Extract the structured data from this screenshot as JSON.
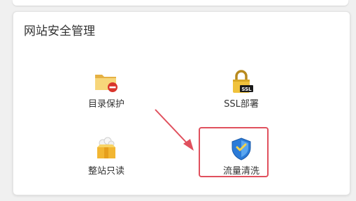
{
  "panel": {
    "title": "网站安全管理",
    "tools": [
      {
        "label": "目录保护",
        "icon": "folder-lock-icon"
      },
      {
        "label": "SSL部署",
        "icon": "ssl-padlock-icon"
      },
      {
        "label": "整站只读",
        "icon": "package-readonly-icon"
      },
      {
        "label": "流量清洗",
        "icon": "shield-icon"
      }
    ]
  },
  "colors": {
    "highlight": "#e0505d",
    "arrow": "#e0505d",
    "folder": "#f2c250",
    "shield": "#2b7bd8"
  }
}
